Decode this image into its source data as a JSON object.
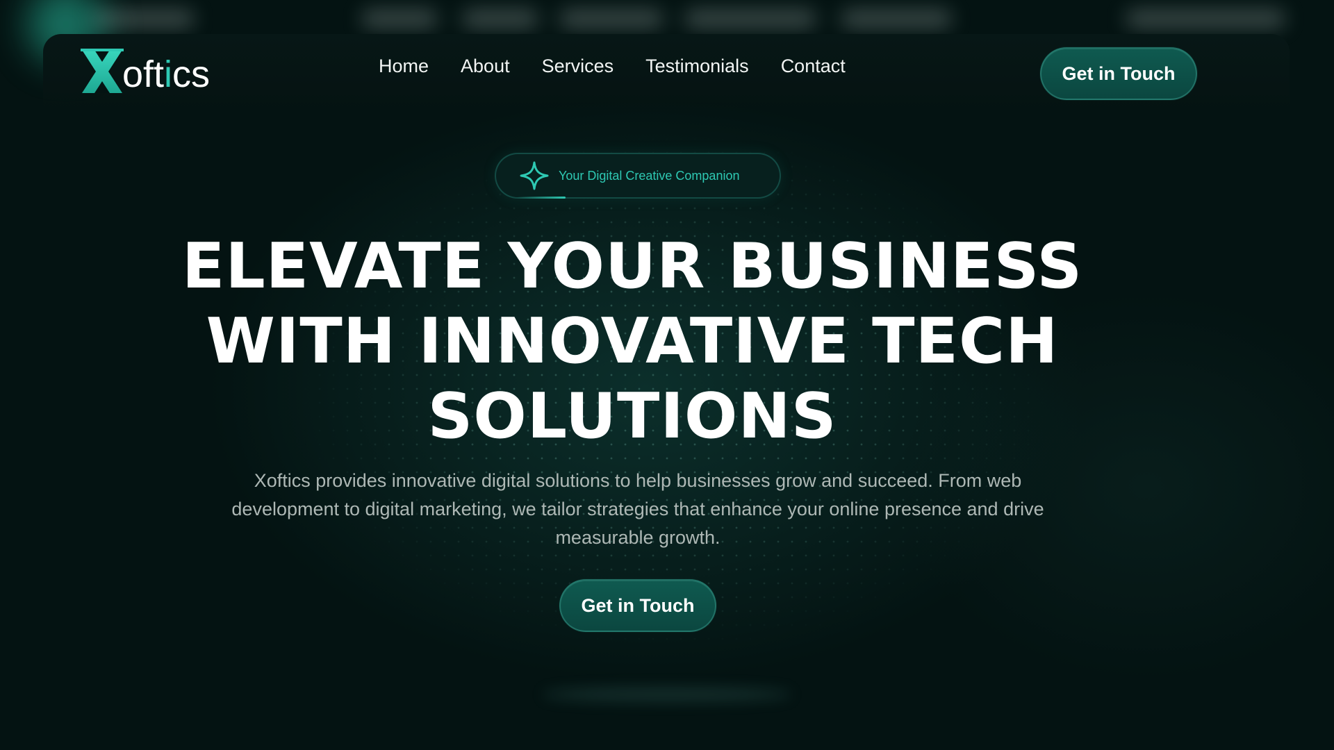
{
  "brand": {
    "logo_prefix": "oft",
    "logo_accent": "i",
    "logo_suffix": "cs",
    "accent_color": "#2ec9b3"
  },
  "nav": {
    "items": [
      {
        "label": "Home"
      },
      {
        "label": "About"
      },
      {
        "label": "Services"
      },
      {
        "label": "Testimonials"
      },
      {
        "label": "Contact"
      }
    ],
    "cta_label": "Get in Touch"
  },
  "hero": {
    "badge_icon": "sparkle-icon",
    "badge_text": "Your Digital Creative Companion",
    "headline_line1": "ELEVATE YOUR BUSINESS",
    "headline_line2": "WITH INNOVATIVE TECH",
    "headline_line3": "SOLUTIONS",
    "subtitle": "Xoftics provides innovative digital solutions to help businesses grow and succeed. From web development to digital marketing, we tailor strategies that enhance your online presence and drive measurable growth.",
    "cta_label": "Get in Touch"
  },
  "colors": {
    "background": "#041312",
    "button": "#0f5a50",
    "muted_text": "#aeb8b5"
  }
}
